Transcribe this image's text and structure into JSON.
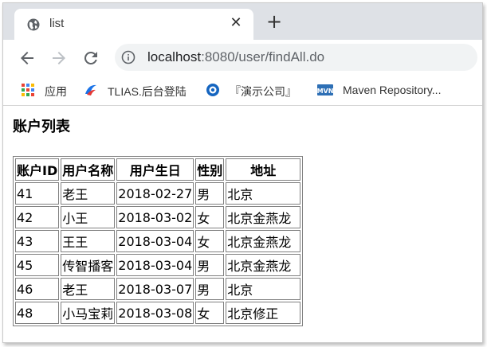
{
  "tab": {
    "title": "list",
    "close_glyph": "✕",
    "new_tab_glyph": "+"
  },
  "toolbar": {
    "url_host": "localhost",
    "url_path": ":8080/user/findAll.do"
  },
  "bookmarks": [
    {
      "label": "应用",
      "icon": "apps-grid-icon"
    },
    {
      "label": "TLIAS.后台登陆",
      "icon": "tlias-logo-icon"
    },
    {
      "label": "『演示公司』",
      "icon": "demo-company-icon"
    },
    {
      "label": "Maven Repository...",
      "icon": "maven-icon"
    }
  ],
  "page": {
    "heading": "账户列表",
    "table": {
      "headers": [
        "账户ID",
        "用户名称",
        "用户生日",
        "性别",
        "地址"
      ],
      "rows": [
        [
          "41",
          "老王",
          "2018-02-27",
          "男",
          "北京"
        ],
        [
          "42",
          "小王",
          "2018-03-02",
          "女",
          "北京金燕龙"
        ],
        [
          "43",
          "王王",
          "2018-03-04",
          "女",
          "北京金燕龙"
        ],
        [
          "45",
          "传智播客",
          "2018-03-04",
          "男",
          "北京金燕龙"
        ],
        [
          "46",
          "老王",
          "2018-03-07",
          "男",
          "北京"
        ],
        [
          "48",
          "小马宝莉",
          "2018-03-08",
          "女",
          "北京修正"
        ]
      ]
    }
  }
}
